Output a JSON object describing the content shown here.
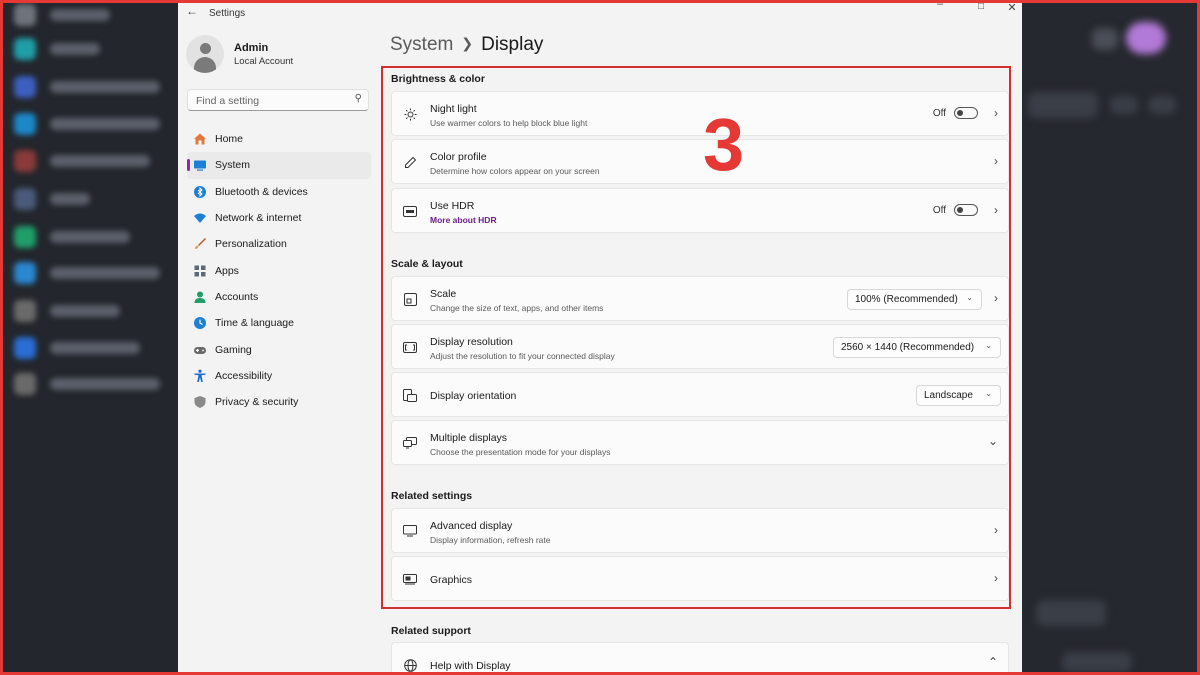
{
  "window": {
    "app_title": "Settings"
  },
  "user": {
    "name": "Admin",
    "account_type": "Local Account"
  },
  "search": {
    "placeholder": "Find a setting"
  },
  "nav": {
    "items": [
      {
        "label": "Home",
        "icon": "home-icon",
        "color": "#e0783c"
      },
      {
        "label": "System",
        "icon": "system-icon",
        "color": "#1c7fd4",
        "active": true
      },
      {
        "label": "Bluetooth & devices",
        "icon": "bluetooth-icon",
        "color": "#1c7fd4"
      },
      {
        "label": "Network & internet",
        "icon": "network-icon",
        "color": "#1c7fd4"
      },
      {
        "label": "Personalization",
        "icon": "brush-icon",
        "color": "#c2571a"
      },
      {
        "label": "Apps",
        "icon": "apps-icon",
        "color": "#5a6a7a"
      },
      {
        "label": "Accounts",
        "icon": "accounts-icon",
        "color": "#1f9e6a"
      },
      {
        "label": "Time & language",
        "icon": "time-language-icon",
        "color": "#1c7fd4"
      },
      {
        "label": "Gaming",
        "icon": "gaming-icon",
        "color": "#6a6a6a"
      },
      {
        "label": "Accessibility",
        "icon": "accessibility-icon",
        "color": "#1c6ed4"
      },
      {
        "label": "Privacy & security",
        "icon": "shield-icon",
        "color": "#6a6a6a"
      }
    ]
  },
  "breadcrumb": {
    "parent": "System",
    "current": "Display"
  },
  "sections": {
    "brightness": {
      "title": "Brightness & color",
      "night_light": {
        "title": "Night light",
        "subtitle": "Use warmer colors to help block blue light",
        "state": "Off"
      },
      "color_profile": {
        "title": "Color profile",
        "subtitle": "Determine how colors appear on your screen"
      },
      "hdr": {
        "title": "Use HDR",
        "link": "More about HDR",
        "state": "Off"
      }
    },
    "scale_layout": {
      "title": "Scale & layout",
      "scale": {
        "title": "Scale",
        "subtitle": "Change the size of text, apps, and other items",
        "value": "100% (Recommended)"
      },
      "resolution": {
        "title": "Display resolution",
        "subtitle": "Adjust the resolution to fit your connected display",
        "value": "2560 × 1440 (Recommended)"
      },
      "orientation": {
        "title": "Display orientation",
        "value": "Landscape"
      },
      "multiple": {
        "title": "Multiple displays",
        "subtitle": "Choose the presentation mode for your displays"
      }
    },
    "related_settings": {
      "title": "Related settings",
      "advanced": {
        "title": "Advanced display",
        "subtitle": "Display information, refresh rate"
      },
      "graphics": {
        "title": "Graphics"
      }
    },
    "related_support": {
      "title": "Related support",
      "help": {
        "title": "Help with Display"
      }
    }
  },
  "annotation": {
    "number": "3",
    "color": "#e53935"
  },
  "colors": {
    "accent": "#8e2ba3",
    "link": "#6b1e8c",
    "highlight": "#d32f2f"
  }
}
